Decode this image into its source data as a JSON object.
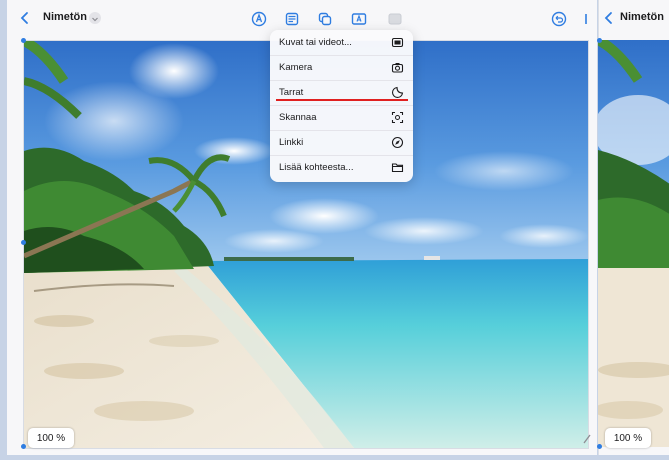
{
  "window": {
    "title": "Nimetön",
    "zoom": "100 %"
  },
  "toolbar": {
    "icons": [
      "pen-circle-icon",
      "text-box-icon",
      "shapes-icon",
      "textfield-icon",
      "media-icon",
      "undo-icon",
      "share-icon"
    ]
  },
  "menu": {
    "items": [
      {
        "label": "Kuvat tai videot...",
        "icon": "photo-icon"
      },
      {
        "label": "Kamera",
        "icon": "camera-icon"
      },
      {
        "label": "Tarrat",
        "icon": "sticker-icon"
      },
      {
        "label": "Skannaa",
        "icon": "scan-icon"
      },
      {
        "label": "Linkki",
        "icon": "link-icon"
      },
      {
        "label": "Lisää kohteesta...",
        "icon": "folder-icon"
      }
    ],
    "highlighted": "Tarrat",
    "highlight_color": "#e02020"
  },
  "second_window": {
    "title": "Nimetön",
    "zoom": "100 %"
  },
  "colors": {
    "accent": "#2f7de1",
    "sky": "#3f86d6",
    "sea": "#5fd0d8",
    "sand": "#efe6d5"
  }
}
